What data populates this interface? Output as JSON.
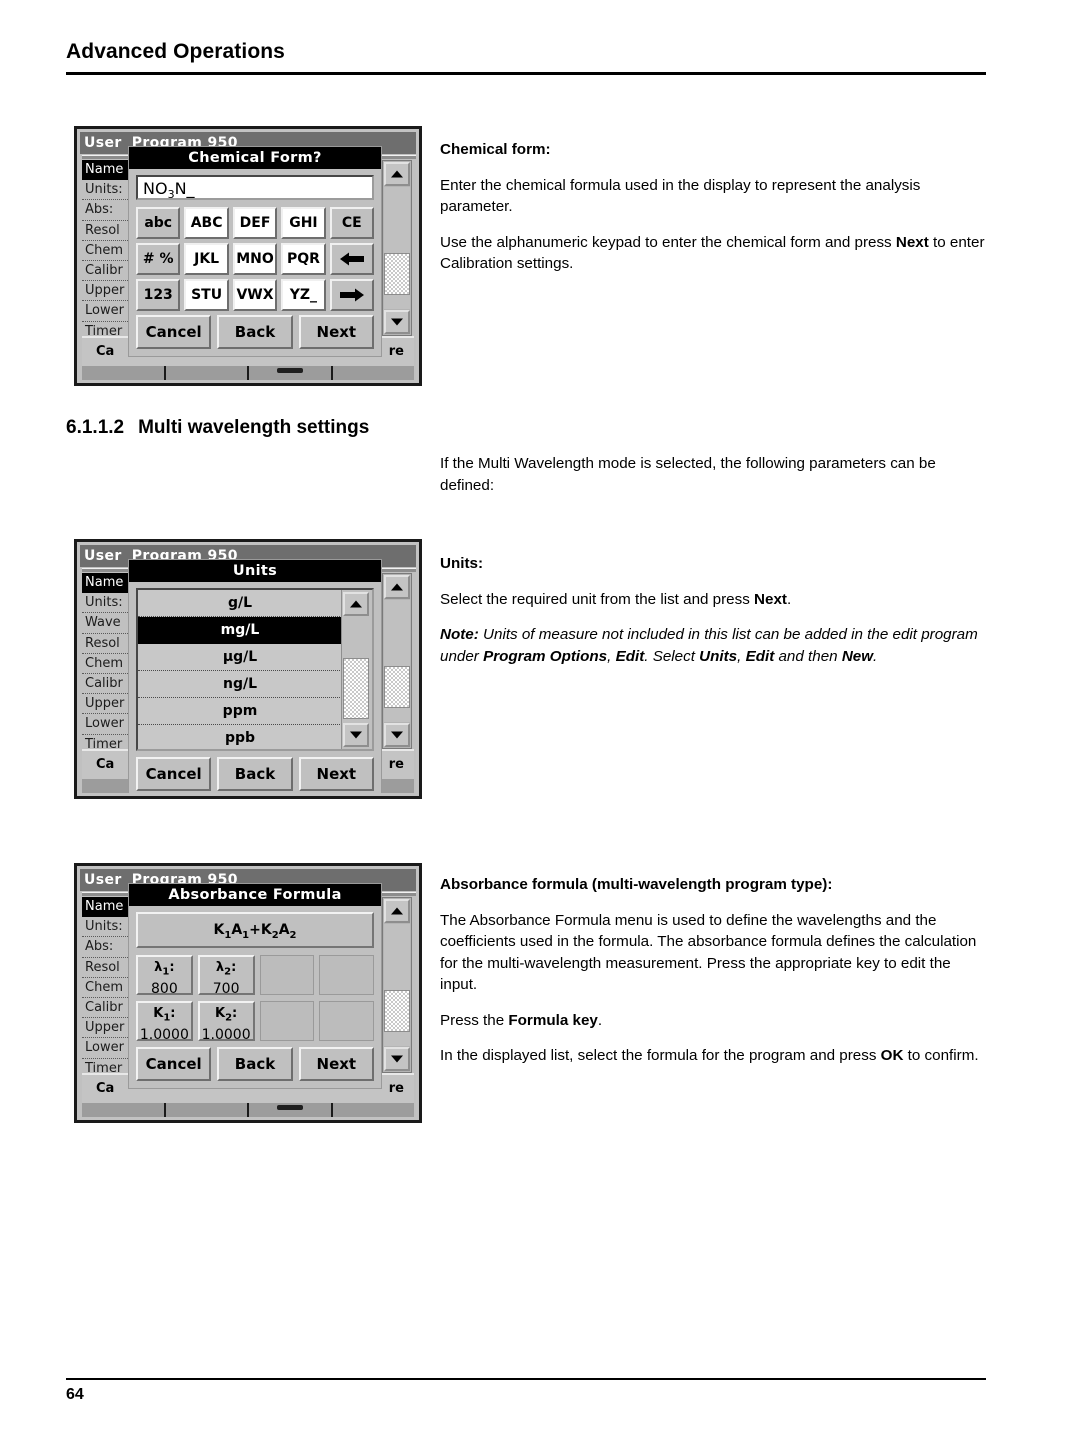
{
  "page": {
    "header_title": "Advanced Operations",
    "footer_number": "64"
  },
  "sections": {
    "multi_wavelength": {
      "number": "6.1.1.2",
      "title": "Multi wavelength settings"
    }
  },
  "copy": {
    "chemical_form_heading": "Chemical form:",
    "chemical_form_p1": "Enter the chemical formula used in the display to represent the analysis parameter.",
    "chemical_form_p2_a": "Use the alphanumeric keypad to enter the chemical form and press ",
    "chemical_form_p2_b": "Next",
    "chemical_form_p2_c": " to enter Calibration settings.",
    "multi_intro": "If the Multi Wavelength mode is selected, the following parameters can be defined:",
    "units_heading": "Units:",
    "units_p1_a": "Select the required unit from the list and press ",
    "units_p1_b": "Next",
    "units_p1_c": ".",
    "units_note_label": "Note:",
    "units_note_a": " Units of measure not included in this list can be added in the edit program under ",
    "units_note_b": "Program Options",
    "units_note_c": ", ",
    "units_note_d": "Edit",
    "units_note_e": ". Select ",
    "units_note_f": "Units",
    "units_note_g": ", ",
    "units_note_h": "Edit",
    "units_note_i": " and then ",
    "units_note_j": "New",
    "units_note_k": ".",
    "absorbance_heading": "Absorbance formula (multi-wavelength program type):",
    "absorbance_p1": "The Absorbance Formula menu is used to define the wavelengths and the coefficients used in the formula. The absorbance formula defines the calculation for the multi-wavelength measurement. Press the appropriate key to edit the input.",
    "absorbance_p2_a": "Press the ",
    "absorbance_p2_b": "Formula key",
    "absorbance_p2_c": ".",
    "absorbance_p3_a": "In the displayed list, select the formula for the program and press ",
    "absorbance_p3_b": "OK",
    "absorbance_p3_c": " to confirm."
  },
  "screens": {
    "chemical_form": {
      "app_title": "User",
      "app_program": "Program   950",
      "background_rows": [
        "Name",
        "Units:",
        "Abs: ",
        "Resol",
        "Chem",
        "Calibr",
        "Upper",
        "Lower",
        "Timer",
        "Timer"
      ],
      "bottom_left": "Ca",
      "bottom_right": "re",
      "dialog_title": "Chemical Form?",
      "input_value_main": "NO",
      "input_value_sub": "3",
      "input_value_tail": "N_",
      "keys": [
        [
          "abc",
          "ABC",
          "DEF",
          "GHI",
          "CE"
        ],
        [
          "# %",
          "JKL",
          "MNO",
          "PQR",
          "arrow-left-icon"
        ],
        [
          "123",
          "STU",
          "VWX",
          "YZ_",
          "arrow-right-icon"
        ]
      ],
      "actions": [
        "Cancel",
        "Back",
        "Next"
      ]
    },
    "units": {
      "app_title": "User",
      "app_program": "Program   950",
      "background_rows": [
        "Name",
        "Units:",
        "Wave",
        "Resol",
        "Chem",
        "Calibr",
        "Upper",
        "Lower",
        "Timer",
        "Timer"
      ],
      "bottom_left": "Ca",
      "bottom_right": "re",
      "dialog_title": "Units",
      "items": [
        "g/L",
        "mg/L",
        "µg/L",
        "ng/L",
        "ppm",
        "ppb"
      ],
      "selected_item": "mg/L",
      "actions": [
        "Cancel",
        "Back",
        "Next"
      ]
    },
    "absorbance_formula": {
      "app_title": "User",
      "app_program": "Program   950",
      "background_rows": [
        "Name",
        "Units:",
        "Abs: ",
        "Resol",
        "Chem",
        "Calibr",
        "Upper",
        "Lower",
        "Timer",
        "Timer"
      ],
      "bottom_left": "Ca",
      "bottom_right": "re",
      "dialog_title": "Absorbance Formula",
      "formula_label_k1": "K",
      "formula_label_sub1": "1",
      "formula_label_a1": "A",
      "formula_label_sub1b": "1",
      "formula_plus": "+",
      "formula_label_k2": "K",
      "formula_label_sub2": "2",
      "formula_label_a2": "A",
      "formula_label_sub2b": "2",
      "cells": [
        {
          "label": "λ",
          "sub": "1",
          "colon": ":",
          "value": "800",
          "filled": true
        },
        {
          "label": "λ",
          "sub": "2",
          "colon": ":",
          "value": "700",
          "filled": true
        },
        {
          "label": "",
          "sub": "",
          "colon": "",
          "value": "",
          "filled": false
        },
        {
          "label": "",
          "sub": "",
          "colon": "",
          "value": "",
          "filled": false
        },
        {
          "label": "K",
          "sub": "1",
          "colon": ":",
          "value": "1.0000",
          "filled": true
        },
        {
          "label": "K",
          "sub": "2",
          "colon": ":",
          "value": "1.0000",
          "filled": true
        },
        {
          "label": "",
          "sub": "",
          "colon": "",
          "value": "",
          "filled": false
        },
        {
          "label": "",
          "sub": "",
          "colon": "",
          "value": "",
          "filled": false
        }
      ],
      "actions": [
        "Cancel",
        "Back",
        "Next"
      ]
    }
  },
  "colors": {
    "page_background": "#ffffff",
    "ink": "#000000",
    "device_chrome": "#c0c0c0",
    "titlebar": "#6e6e6e",
    "dialog_title_bg": "#000000"
  }
}
